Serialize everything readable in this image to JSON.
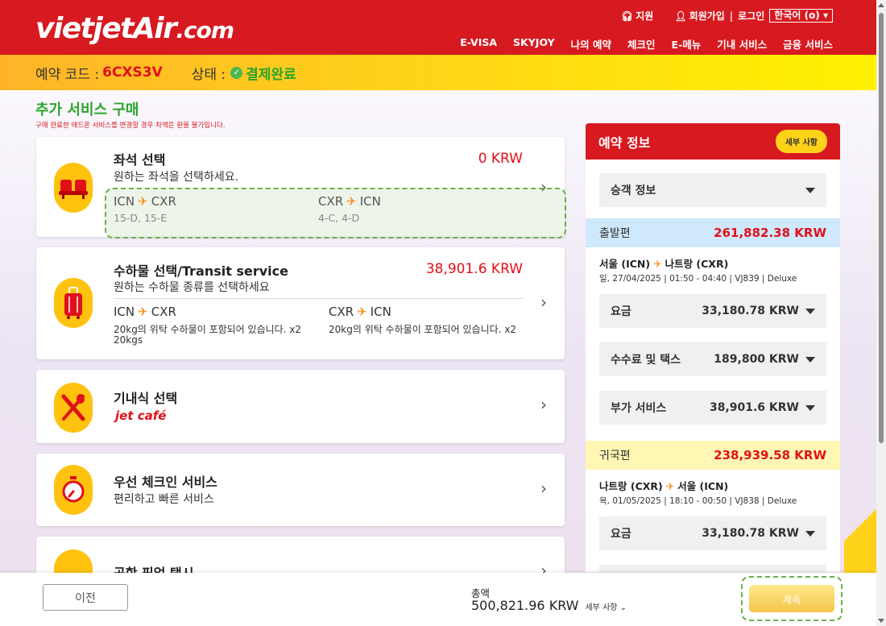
{
  "header": {
    "logo": "vietjetAir",
    "logo_suffix": ".com",
    "util": {
      "support": "지원",
      "signup": "회원가입",
      "login": "로그인",
      "language": "한국어 (o)"
    },
    "nav": [
      "E-VISA",
      "SKYJOY",
      "나의 예약",
      "체크인",
      "E-메뉴",
      "기내 서비스",
      "금융 서비스"
    ]
  },
  "booking": {
    "code_label": "예약 코드 :",
    "code": "6CXS3V",
    "status_label": "상태 :",
    "status": "결제완료"
  },
  "section": {
    "title": "추가 서비스 구매",
    "note": "구매 완료한 애드온 서비스를 변경할 경우 차액은 환불 불가입니다."
  },
  "services": {
    "seat": {
      "title": "좌석 선택",
      "subtitle": "원하는 좌석을 선택하세요.",
      "price": "0 KRW",
      "out_from": "ICN",
      "out_to": "CXR",
      "out_detail": "15-D, 15-E",
      "ret_from": "CXR",
      "ret_to": "ICN",
      "ret_detail": "4-C, 4-D"
    },
    "baggage": {
      "title": "수하물 선택/Transit service",
      "subtitle": "원하는 수하물 종류를 선택하세요",
      "price": "38,901.6 KRW",
      "out_from": "ICN",
      "out_to": "CXR",
      "out_detail": "20kg의 위탁 수하물이 포함되어 있습니다. x2",
      "out_detail2": "20kgs",
      "ret_from": "CXR",
      "ret_to": "ICN",
      "ret_detail": "20kg의 위탁 수하물이 포함되어 있습니다. x2"
    },
    "meal": {
      "title": "기내식 선택",
      "brand": "jet café"
    },
    "priority": {
      "title": "우선 체크인 서비스",
      "subtitle": "편리하고 빠른 서비스"
    },
    "pickup": {
      "title": "공항 픽업 택시"
    }
  },
  "panel": {
    "title": "예약 정보",
    "details_button": "세부 사항",
    "passenger": "승객 정보",
    "outbound": {
      "label": "출발편",
      "total": "261,882.38 KRW",
      "route_from": "서울 (ICN)",
      "route_to": "나트랑 (CXR)",
      "info": "일, 27/04/2025 | 01:50 - 04:40 | VJ839 | Deluxe",
      "fare_label": "요금",
      "fare": "33,180.78 KRW",
      "tax_label": "수수료 및 택스",
      "tax": "189,800 KRW",
      "addon_label": "부가 서비스",
      "addon": "38,901.6 KRW"
    },
    "inbound": {
      "label": "귀국편",
      "total": "238,939.58 KRW",
      "route_from": "나트랑 (CXR)",
      "route_to": "서울 (ICN)",
      "info": "목, 01/05/2025 | 18:10 - 00:50 | VJ838 | Deluxe",
      "fare_label": "요금",
      "fare": "33,180.78 KRW"
    }
  },
  "footer": {
    "prev": "이전",
    "total_label": "총액",
    "total": "500,821.96 KRW",
    "details": "세부 사항",
    "continue": "계속"
  }
}
